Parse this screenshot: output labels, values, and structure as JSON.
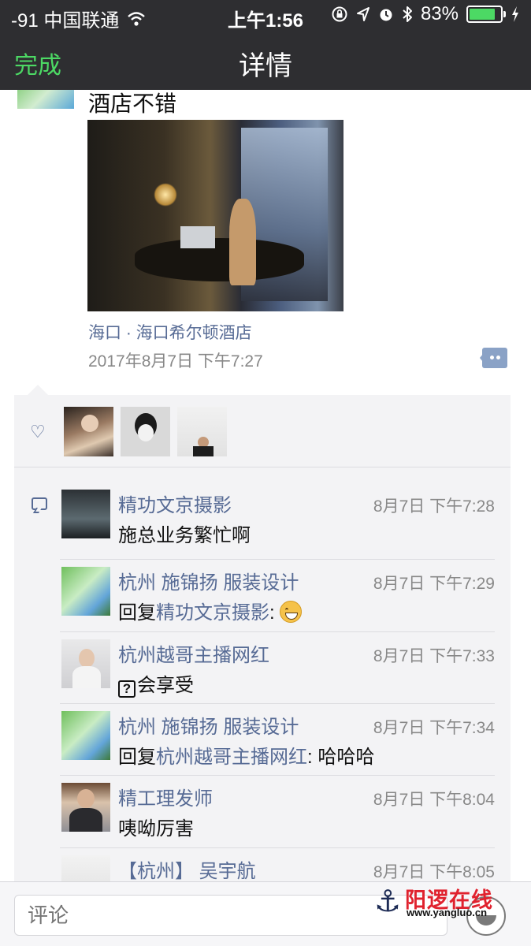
{
  "status_bar": {
    "carrier": "-91 中国联通",
    "time": "上午1:56",
    "battery": "83%",
    "battery_level": 0.83,
    "icons": [
      "wifi-icon",
      "orientation-lock-icon",
      "location-icon",
      "alarm-icon",
      "bluetooth-icon",
      "battery-icon",
      "charging-icon"
    ]
  },
  "nav": {
    "done_label": "完成",
    "title": "详情"
  },
  "colors": {
    "nav_bg": "#2e2e31",
    "accent_green": "#4cd964",
    "link_blue": "#576b95",
    "panel_bg": "#f3f3f5"
  },
  "post": {
    "text": "酒店不错",
    "location": "海口 · 海口希尔顿酒店",
    "time": "2017年8月7日 下午7:27"
  },
  "likes": {
    "count": 3
  },
  "comments": [
    {
      "name": "精功文京摄影",
      "time": "8月7日 下午7:28",
      "text": "施总业务繁忙啊"
    },
    {
      "name": "杭州 施锦扬 服装设计",
      "time": "8月7日 下午7:29",
      "reply_prefix": "回复",
      "reply_to": "精功文京摄影",
      "text": ": ",
      "emoji": "grin-emoji"
    },
    {
      "name": "杭州越哥主播网红",
      "time": "8月7日 下午7:33",
      "text": "会享受",
      "glyph": "unknown-glyph"
    },
    {
      "name": "杭州 施锦扬 服装设计",
      "time": "8月7日 下午7:34",
      "reply_prefix": "回复",
      "reply_to": "杭州越哥主播网红",
      "text": ": 哈哈哈"
    },
    {
      "name": "精工理发师",
      "time": "8月7日 下午8:04",
      "text": "咦呦厉害"
    },
    {
      "name": "【杭州】 吴宇航",
      "time": "8月7日 下午8:05"
    }
  ],
  "input": {
    "placeholder": "评论"
  },
  "watermark": {
    "title": "阳逻在线",
    "url": "www.yangluo.cn"
  }
}
